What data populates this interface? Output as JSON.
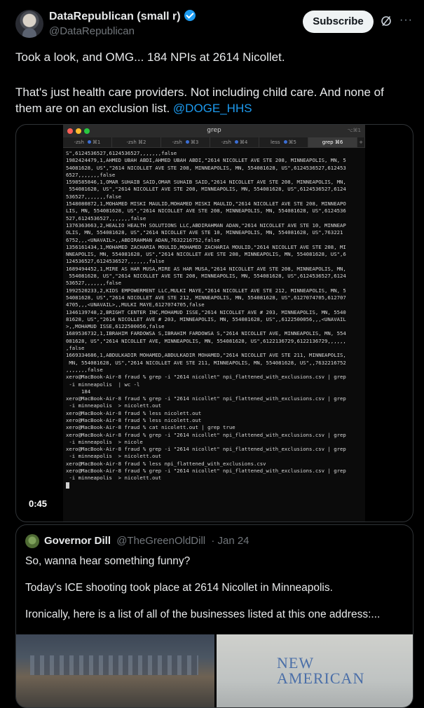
{
  "author": {
    "display_name": "DataRepublican (small r)",
    "handle": "@DataRepublican",
    "subscribe_label": "Subscribe",
    "more_glyph": "···"
  },
  "post": {
    "line1": "Took a look, and OMG... 184 NPIs at 2614 Nicollet.",
    "line2": "That's just health care providers. Not including child care. And none of",
    "line3_prefix": "them are on an exclusion list.",
    "line3_mention": "@DOGE_HHS"
  },
  "video": {
    "timer": "0:45",
    "terminal": {
      "title": "grep",
      "title_shortcut": "⌥⌘1",
      "tabs": [
        {
          "label": "-zsh",
          "shortcut": "⌘1",
          "dot": true
        },
        {
          "label": "-zsh",
          "shortcut": "⌘2",
          "dot": false
        },
        {
          "label": "-zsh",
          "shortcut": "⌘3",
          "dot": true
        },
        {
          "label": "-zsh",
          "shortcut": "⌘4",
          "dot": true
        },
        {
          "label": "less",
          "shortcut": "⌘5",
          "dot": true
        },
        {
          "label": "grep",
          "shortcut": "⌘6",
          "dot": false,
          "active": true
        }
      ],
      "lines": [
        "S\",6124536527,6124536527,,,,,,,false",
        "1982424479,1,AHMED UBAH ABDI,AHMED UBAH ABDI,\"2614 NICOLLET AVE STE 208, MINNEAPOLIS, MN, 5",
        "54081628, US\",\"2614 NICOLLET AVE STE 208, MINNEAPOLIS, MN, 554081628, US\",6124536527,612453",
        "6527,,,,,,,false",
        "1598585846,1,OMAR SUHAIB SAID,OMAR SUHAIB SAID,\"2614 NICOLLET AVE STE 208, MINNEAPOLIS, MN,",
        " 554081628, US\",\"2614 NICOLLET AVE STE 208, MINNEAPOLIS, MN, 554081628, US\",6124536527,6124",
        "536527,,,,,,,false",
        "1548080872,1,MOHAMED MISKI MAULID,MOHAMED MISKI MAULID,\"2614 NICOLLET AVE STE 208, MINNEAPO",
        "LIS, MN, 554081628, US\",\"2614 NICOLLET AVE STE 208, MINNEAPOLIS, MN, 554081628, US\",6124536",
        "527,6124536527,,,,,,,false",
        "1376363663,2,HEALIO HEALTH SOLUTIONS LLC,ABDIRAHMAN ADAN,\"2614 NICOLLET AVE STE 10, MINNEAP",
        "OLIS, MN, 554081628, US\",\"2614 NICOLLET AVE STE 10, MINNEAPOLIS, MN, 554081628, US\",763221",
        "6752,,,<UNAVAIL>,,ABDIRAHMAN ADAN,7632216752,false",
        "1356161434,1,MOHAMED ZACHARIA MOULID,MOHAMED ZACHARIA MOULID,\"2614 NICOLLET AVE STE 208, MI",
        "NNEAPOLIS, MN, 554081628, US\",\"2614 NICOLLET AVE STE 208, MINNEAPOLIS, MN, 554081628, US\",6",
        "124536527,6124536527,,,,,,,false",
        "1689494452,1,MIRE AS HAR MUSA,MIRE AS HAR MUSA,\"2614 NICOLLET AVE STE 208, MINNEAPOLIS, MN,",
        " 554081628, US\",\"2614 NICOLLET AVE STE 208, MINNEAPOLIS, MN, 554081628, US\",6124536527,6124",
        "536527,,,,,,,false",
        "1992520233,2,KIDS EMPOWERMENT LLC,MULKI MAYE,\"2614 NICOLLET AVE STE 212, MINNEAPOLIS, MN, 5",
        "54081628, US\",\"2614 NICOLLET AVE STE 212, MINNEAPOLIS, MN, 554081628, US\",6127074705,612707",
        "4705,,,<UNAVAIL>,,MULKI MAYE,6127074705,false",
        "1346139748,2,BRIGHT CENTER INC,MOHAMUD ISSE,\"2614 NICOLLET AVE # 203, MINNEAPOLIS, MN, 5540",
        "81628, US\",\"2614 NICOLLET AVE # 203, MINNEAPOLIS, MN, 554081628, US\",,6122500056,,,<UNAVAIL",
        ">,,MOHAMUD ISSE,6122500056,false",
        "1689536732,1,IBRAHIM FARDOWSA S,IBRAHIM FARDOWSA S,\"2614 NICOLLET AVE, MINNEAPOLIS, MN, 554",
        "081628, US\",\"2614 NICOLLET AVE, MINNEAPOLIS, MN, 554081628, US\",6122136729,6122136729,,,,,,",
        ",false",
        "1669334686,1,ABDULKADIR MOHAMED,ABDULKADIR MOHAMED,\"2614 NICOLLET AVE STE 211, MINNEAPOLIS,",
        " MN, 554081628, US\",\"2614 NICOLLET AVE STE 211, MINNEAPOLIS, MN, 554081628, US\",,7632216752",
        ",,,,,,,false",
        "xero@MacBook-Air-8 fraud % grep -i \"2614 nicollet\" npi_flattened_with_exclusions.csv | grep",
        " -i minneapolis  | wc -l",
        "     184",
        "xero@MacBook-Air-8 fraud % grep -i \"2614 nicollet\" npi_flattened_with_exclusions.csv | grep",
        " -i minneapolis  > nicolett.out",
        "xero@MacBook-Air-8 fraud % less nicolett.out",
        "xero@MacBook-Air-8 fraud % less nicolett.out",
        "xero@MacBook-Air-8 fraud % cat nicolett.out | grep true",
        "xero@MacBook-Air-8 fraud % grep -i \"2614 nicollet\" npi_flattened_with_exclusions.csv | grep",
        " -i minneapolis  > nicole",
        "xero@MacBook-Air-8 fraud % grep -i \"2614 nicollet\" npi_flattened_with_exclusions.csv | grep",
        " -i minneapolis  > nicolett.out",
        "xero@MacBook-Air-8 fraud % less npi_flattened_with_exclusions.csv",
        "xero@MacBook-Air-8 fraud % grep -i \"2614 nicollet\" npi_flattened_with_exclusions.csv | grep",
        " -i minneapolis  > nicolett.out"
      ]
    }
  },
  "quote": {
    "name": "Governor Dill",
    "handle": "@TheGreenOldDill",
    "date": "· Jan 24",
    "line1": "So, wanna hear something funny?",
    "line2": "Today's ICE shooting took place at 2614 Nicollet in Minneapolis.",
    "line3": "Ironically, here is a list of all of the businesses listed at this one address:...",
    "image2_text": "NEW\nAMERICAN"
  },
  "colors": {
    "accent": "#1d9bf0",
    "background": "#000000",
    "text": "#e7e9ea",
    "muted": "#71767b"
  }
}
